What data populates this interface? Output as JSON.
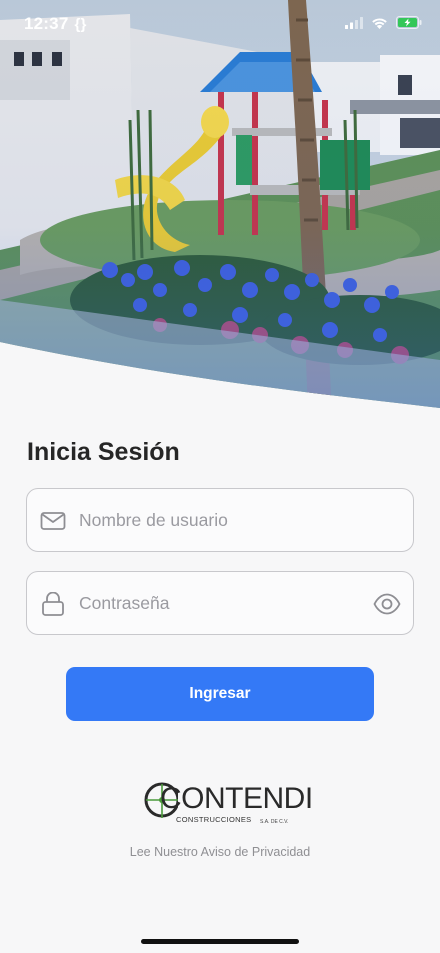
{
  "status_bar": {
    "time": "12:37",
    "indicator": "{}",
    "battery_color": "#34c759"
  },
  "hero": {
    "image": "playground-rendering"
  },
  "login": {
    "title": "Inicia Sesión",
    "username": {
      "placeholder": "Nombre de usuario",
      "icon": "mail-icon"
    },
    "password": {
      "placeholder": "Contraseña",
      "icon": "lock-icon",
      "toggle_icon": "eye-icon"
    },
    "submit_label": "Ingresar"
  },
  "brand": {
    "name": "CONTENDI",
    "tagline": "CONSTRUCCIONES",
    "legal": "S.A. DE C.V."
  },
  "footer": {
    "privacy_link": "Lee Nuestro Aviso de Privacidad"
  },
  "colors": {
    "primary": "#3479f6",
    "text": "#262626",
    "placeholder": "#9a9aa0",
    "border": "#c8c8cc",
    "logo_accent": "#4a9a3a"
  }
}
